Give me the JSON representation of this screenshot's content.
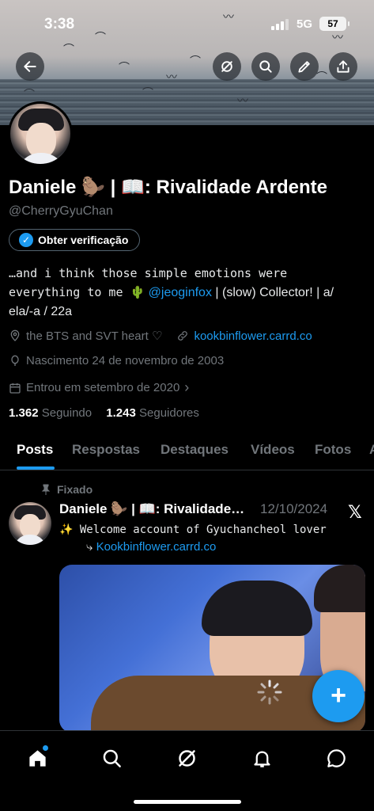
{
  "status_bar": {
    "time": "3:38",
    "network": "5G",
    "battery": "57"
  },
  "profile": {
    "name": "Daniele 🦫 | 📖: Rivalidade Ardente",
    "handle": "@CherryGyuChan",
    "verify_label": "Obter verificação",
    "bio_line1": "…and i think those simple emotions were",
    "bio_line2_mono": "everything to me 🌵",
    "bio_mention": "@jeoginfox",
    "bio_line2_rest": " | (slow) Collector! | a/",
    "bio_line3": "ela/-a / 22a",
    "location": "the BTS and SVT heart ♡",
    "website": "kookbinflower.carrd.co",
    "birthday": "Nascimento 24 de novembro de 2003",
    "joined": "Entrou em setembro de 2020",
    "following_count": "1.362",
    "following_label": "Seguindo",
    "followers_count": "1.243",
    "followers_label": "Seguidores"
  },
  "tabs": [
    "Posts",
    "Respostas",
    "Destaques",
    "Vídeos",
    "Fotos",
    "A"
  ],
  "post": {
    "pinned_label": "Fixado",
    "author": "Daniele 🦫 | 📖: Rivalidade…",
    "date": "12/10/2024",
    "text_line1": "✨ Welcome account of Gyuchancheol lover",
    "text_link_prefix": "⤷ ",
    "text_link": "Kookbinflower.carrd.co"
  },
  "icons": {
    "back": "arrow-left-icon",
    "grok": "grok-icon",
    "search": "search-icon",
    "edit": "pencil-icon",
    "share": "share-icon",
    "fab": "plus-icon"
  },
  "colors": {
    "accent": "#1d9bf0",
    "background": "#000000",
    "muted": "#71767b"
  }
}
